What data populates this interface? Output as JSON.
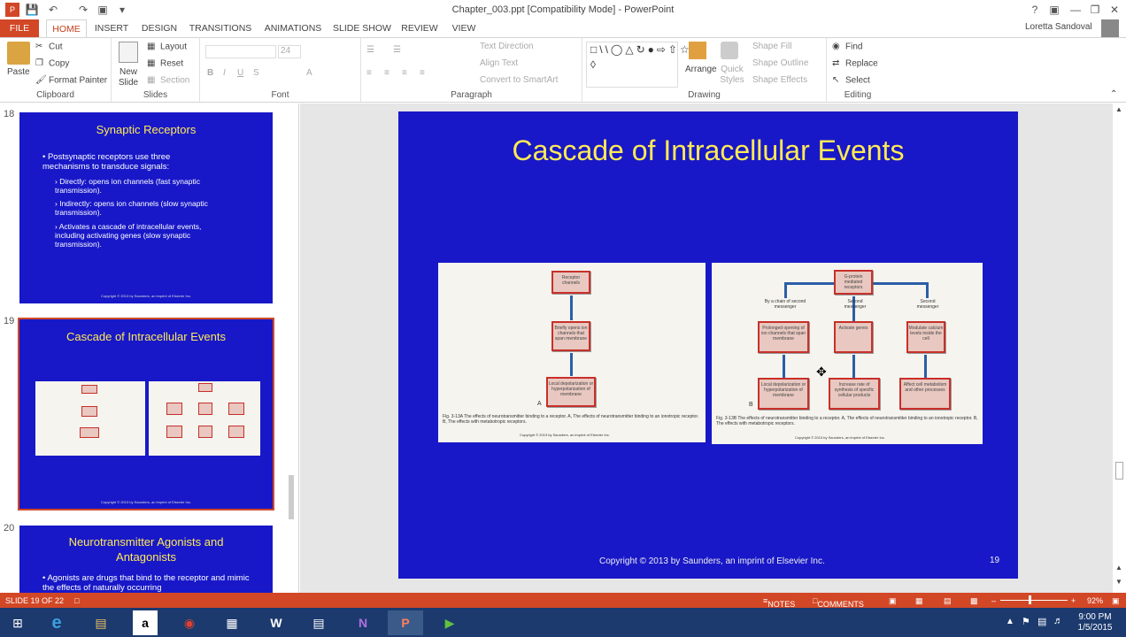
{
  "window": {
    "title": "Chapter_003.ppt [Compatibility Mode] - PowerPoint",
    "user": "Loretta Sandoval"
  },
  "tabs": [
    "FILE",
    "HOME",
    "INSERT",
    "DESIGN",
    "TRANSITIONS",
    "ANIMATIONS",
    "SLIDE SHOW",
    "REVIEW",
    "VIEW"
  ],
  "ribbon": {
    "clipboard": {
      "paste": "Paste",
      "cut": "Cut",
      "copy": "Copy",
      "format_painter": "Format Painter",
      "label": "Clipboard"
    },
    "slides": {
      "new_slide": "New Slide",
      "layout": "Layout",
      "reset": "Reset",
      "section": "Section",
      "label": "Slides"
    },
    "font": {
      "size": "24",
      "label": "Font"
    },
    "paragraph": {
      "text_direction": "Text Direction",
      "align_text": "Align Text",
      "smartart": "Convert to SmartArt",
      "label": "Paragraph"
    },
    "drawing": {
      "arrange": "Arrange",
      "quick_styles": "Quick Styles",
      "shape_fill": "Shape Fill",
      "shape_outline": "Shape Outline",
      "shape_effects": "Shape Effects",
      "label": "Drawing"
    },
    "editing": {
      "find": "Find",
      "replace": "Replace",
      "select": "Select",
      "label": "Editing"
    }
  },
  "thumbnails": [
    {
      "num": "18",
      "title": "Synaptic Receptors",
      "bullet": "Postsynaptic receptors use three mechanisms to transduce signals:",
      "sub": [
        "Directly: opens ion channels (fast synaptic transmission).",
        "Indirectly: opens ion channels (slow synaptic transmission).",
        "Activates a cascade of intracellular events, including activating genes (slow synaptic transmission)."
      ],
      "copyright": "Copyright © 2013 by Saunders, an imprint of Elsevier Inc."
    },
    {
      "num": "19",
      "title": "Cascade of Intracellular Events",
      "copyright": "Copyright © 2013 by Saunders, an imprint of Elsevier Inc."
    },
    {
      "num": "20",
      "title": "Neurotransmitter Agonists and Antagonists",
      "bullet": "Agonists are drugs that bind to the receptor and mimic the effects of naturally occurring"
    }
  ],
  "slide": {
    "title": "Cascade of Intracellular Events",
    "copyright": "Copyright © 2013 by Saunders, an imprint of Elsevier Inc.",
    "number": "19",
    "figA": {
      "boxes": [
        "Receptor channels",
        "Briefly opens ion channels that span membrane",
        "Local depolarization or hyperpolarization of membrane"
      ],
      "letter": "A",
      "caption": "Fig. 3-13A The effects of neurotransmitter binding to a receptor. A, The effects of neurotransmitter binding to an ionotropic receptor. B, The effects with metabotropic receptors.",
      "copyright": "Copyright © 2013 by Saunders, an imprint of Elsevier Inc."
    },
    "figB": {
      "top": "G-protein mediated receptors",
      "labels": [
        "By a chain of second messenger",
        "Second messenger",
        "Second messenger"
      ],
      "mid": [
        "Prolonged opening of ion channels that span membrane",
        "Activate genes",
        "Modulate calcium levels inside the cell"
      ],
      "bottom": [
        "Local depolarization or hyperpolarization of membrane",
        "Increase rate of synthesis of specific cellular products",
        "Affect cell metabolism and other processes"
      ],
      "letter": "B",
      "caption": "Fig. 3-13B The effects of neurotransmitter binding to a receptor. A, The effects of neurotransmitter binding to an ionotropic receptor. B, The effects with metabotropic receptors.",
      "copyright": "Copyright © 2013 by Saunders, an imprint of Elsevier Inc."
    }
  },
  "status": {
    "slide_of": "SLIDE 19 OF 22",
    "notes": "NOTES",
    "comments": "COMMENTS",
    "zoom": "92%"
  },
  "taskbar": {
    "time": "9:00 PM",
    "date": "1/5/2015"
  }
}
